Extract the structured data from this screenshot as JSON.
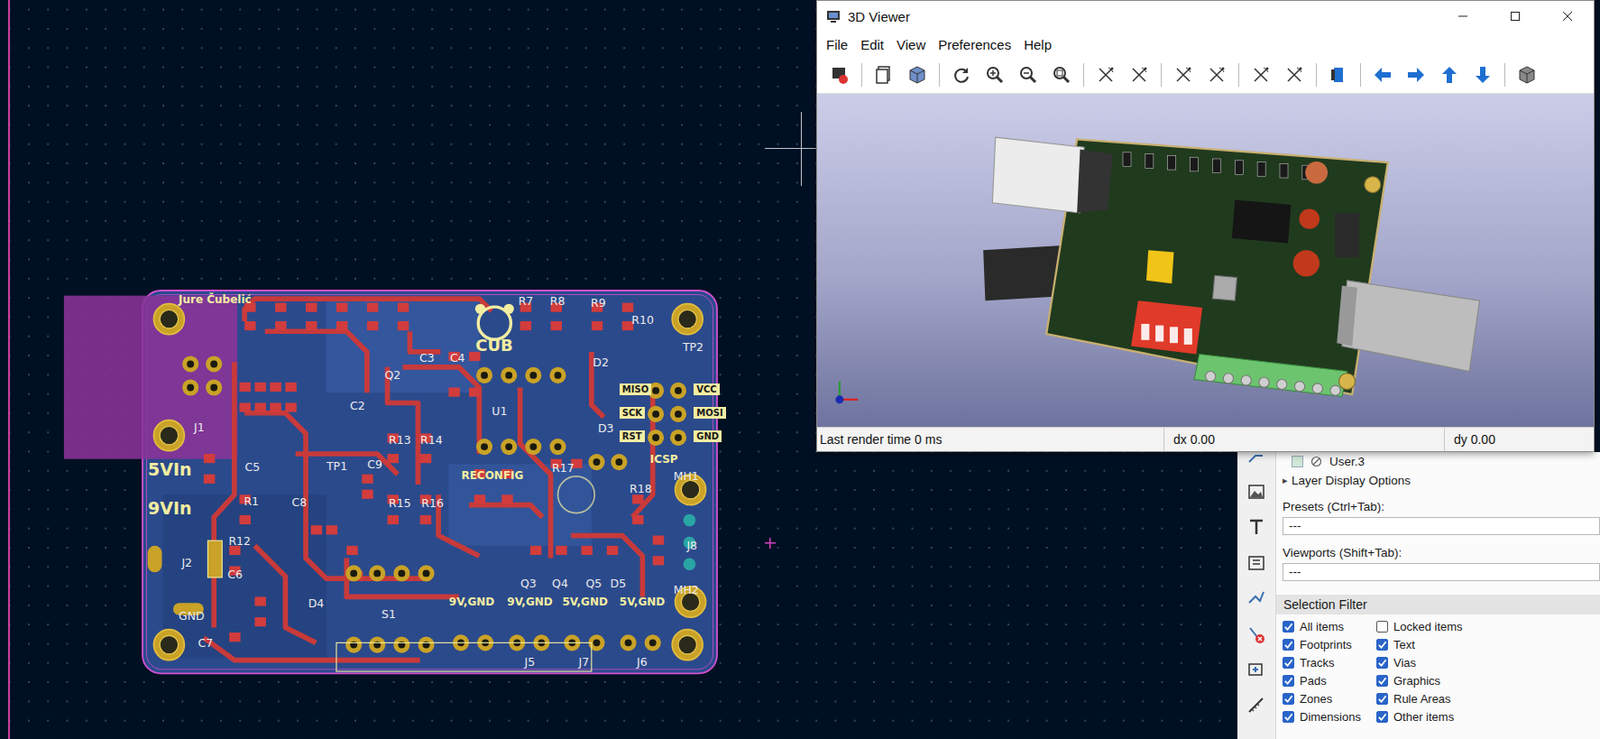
{
  "pcb_editor": {
    "board": {
      "labels": [
        {
          "text": "Jure Čubelić",
          "kind": "silk"
        },
        {
          "text": "CUB",
          "kind": "logo"
        },
        {
          "text": "5VIn",
          "kind": "big"
        },
        {
          "text": "9VIn",
          "kind": "big"
        },
        {
          "text": "J1",
          "kind": "ref"
        },
        {
          "text": "J2",
          "kind": "ref"
        },
        {
          "text": "C5",
          "kind": "ref"
        },
        {
          "text": "R1",
          "kind": "ref"
        },
        {
          "text": "C8",
          "kind": "ref"
        },
        {
          "text": "R12",
          "kind": "ref"
        },
        {
          "text": "C6",
          "kind": "ref"
        },
        {
          "text": "C7",
          "kind": "ref"
        },
        {
          "text": "Q2",
          "kind": "ref"
        },
        {
          "text": "C3",
          "kind": "ref"
        },
        {
          "text": "C4",
          "kind": "ref"
        },
        {
          "text": "C2",
          "kind": "ref"
        },
        {
          "text": "TP1",
          "kind": "ref"
        },
        {
          "text": "C9",
          "kind": "ref"
        },
        {
          "text": "R13",
          "kind": "ref"
        },
        {
          "text": "R14",
          "kind": "ref"
        },
        {
          "text": "R15",
          "kind": "ref"
        },
        {
          "text": "R16",
          "kind": "ref"
        },
        {
          "text": "U1",
          "kind": "ref"
        },
        {
          "text": "RECONFIG",
          "kind": "silk"
        },
        {
          "text": "R17",
          "kind": "ref"
        },
        {
          "text": "R7",
          "kind": "ref"
        },
        {
          "text": "R8",
          "kind": "ref"
        },
        {
          "text": "R9",
          "kind": "ref"
        },
        {
          "text": "R10",
          "kind": "ref"
        },
        {
          "text": "TP2",
          "kind": "ref"
        },
        {
          "text": "D2",
          "kind": "ref"
        },
        {
          "text": "D3",
          "kind": "ref"
        },
        {
          "text": "MISO",
          "kind": "pin"
        },
        {
          "text": "SCK",
          "kind": "pin"
        },
        {
          "text": "RST",
          "kind": "pin"
        },
        {
          "text": "VCC",
          "kind": "pin"
        },
        {
          "text": "MOSI",
          "kind": "pin"
        },
        {
          "text": "GND",
          "kind": "pin"
        },
        {
          "text": "ICSP",
          "kind": "silk"
        },
        {
          "text": "R18",
          "kind": "ref"
        },
        {
          "text": "MH1",
          "kind": "ref"
        },
        {
          "text": "MH2",
          "kind": "ref"
        },
        {
          "text": "J8",
          "kind": "ref"
        },
        {
          "text": "S1",
          "kind": "ref"
        },
        {
          "text": "D4",
          "kind": "ref"
        },
        {
          "text": "Q3",
          "kind": "ref"
        },
        {
          "text": "Q4",
          "kind": "ref"
        },
        {
          "text": "Q5",
          "kind": "ref"
        },
        {
          "text": "D5",
          "kind": "ref"
        },
        {
          "text": "9V,GND",
          "kind": "silk"
        },
        {
          "text": "9V,GND",
          "kind": "silk"
        },
        {
          "text": "5V,GND",
          "kind": "silk"
        },
        {
          "text": "5V,GND",
          "kind": "silk"
        },
        {
          "text": "J5",
          "kind": "ref"
        },
        {
          "text": "J7",
          "kind": "ref"
        },
        {
          "text": "J6",
          "kind": "ref"
        },
        {
          "text": "GND",
          "kind": "ref"
        }
      ]
    },
    "right_panel": {
      "layers": [
        {
          "name": "User.3",
          "visible": false
        }
      ],
      "layer_display_options": {
        "label": "Layer Display Options",
        "icon": "▸",
        "expanded": false
      },
      "presets": {
        "label": "Presets (Ctrl+Tab):",
        "value": "---"
      },
      "viewports": {
        "label": "Viewports (Shift+Tab):",
        "value": "---"
      },
      "selection_filter": {
        "title": "Selection Filter",
        "items": [
          {
            "label": "All items",
            "checked": true
          },
          {
            "label": "Locked items",
            "checked": false
          },
          {
            "label": "Footprints",
            "checked": true
          },
          {
            "label": "Text",
            "checked": true
          },
          {
            "label": "Tracks",
            "checked": true
          },
          {
            "label": "Vias",
            "checked": true
          },
          {
            "label": "Pads",
            "checked": true
          },
          {
            "label": "Graphics",
            "checked": true
          },
          {
            "label": "Zones",
            "checked": true
          },
          {
            "label": "Rule Areas",
            "checked": true
          },
          {
            "label": "Dimensions",
            "checked": true
          },
          {
            "label": "Other items",
            "checked": true
          }
        ]
      }
    }
  },
  "viewer_3d": {
    "title": "3D Viewer",
    "menu": [
      "File",
      "Edit",
      "View",
      "Preferences",
      "Help"
    ],
    "status": {
      "render_time": "Last render time 0 ms",
      "dx": "dx 0.00",
      "dy": "dy 0.00"
    }
  }
}
